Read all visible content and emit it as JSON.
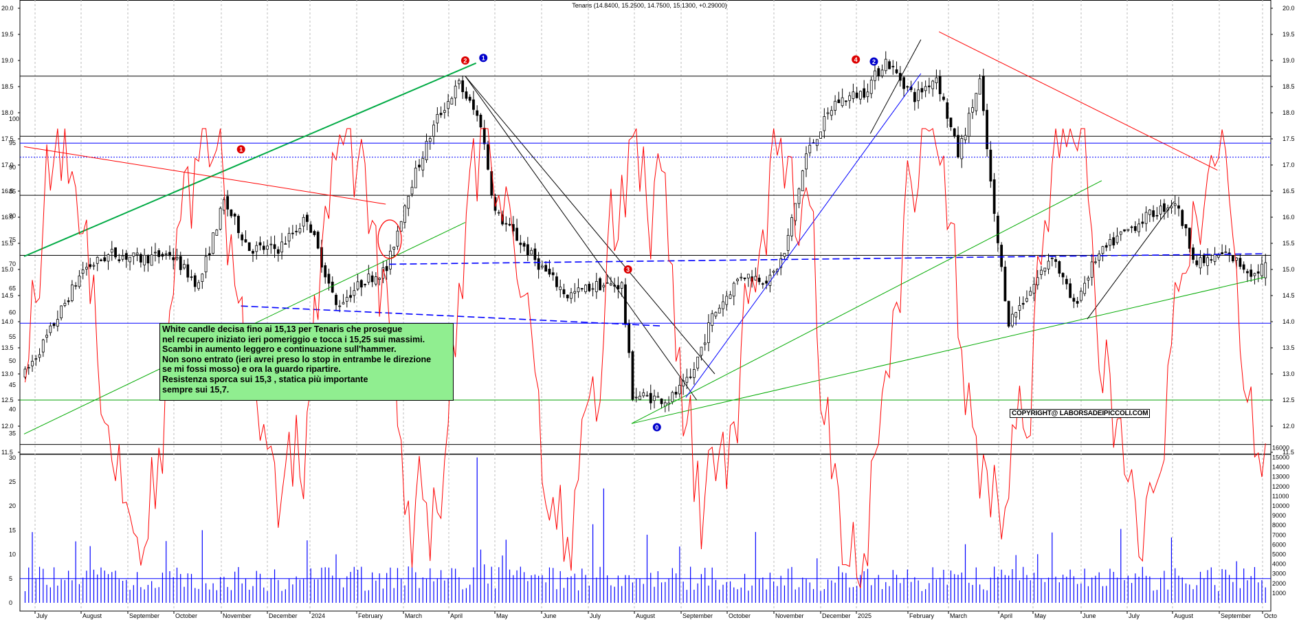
{
  "header": {
    "title": "Tenaris (14.8400, 15.2500, 14.7500, 15.1300, +0.29000)"
  },
  "note": {
    "lines": [
      "White candle decisa fino ai 15,13 per Tenaris che prosegue",
      "nel recupero iniziato ieri pomeriggio e tocca i 15,25 sui massimi.",
      "Scambi in aumento leggero e continuazione sull'hammer.",
      "Non sono entrato (ieri avrei preso lo stop in entrambe le direzione",
      "se mi fossi mosso) e ora la guardo ripartire.",
      "Resistenza sporca sui 15,3 , statica più importante",
      "sempre sui 15,7."
    ]
  },
  "copyright": "COPYRIGHT@ LABORSADEIPICCOLI.COM",
  "chart_data": [
    {
      "type": "candlestick",
      "title": "Tenaris (14.8400, 15.2500, 14.7500, 15.1300, +0.29000)",
      "ylim": [
        11.2,
        20.1
      ],
      "y_ticks": [
        "11.5",
        "12.0",
        "12.5",
        "13.0",
        "13.5",
        "14.0",
        "14.5",
        "15.0",
        "15.5",
        "16.0",
        "16.5",
        "17.0",
        "17.5",
        "18.0",
        "18.5",
        "19.0",
        "19.5",
        "20.0"
      ],
      "x_ticks": [
        "July",
        "August",
        "September",
        "October",
        "November",
        "December",
        "2024",
        "February",
        "March",
        "April",
        "May",
        "June",
        "July",
        "August",
        "September",
        "October",
        "November",
        "December",
        "2025",
        "February",
        "March",
        "April",
        "May",
        "June",
        "July",
        "August",
        "September",
        "Octo"
      ],
      "last": {
        "open": 14.84,
        "high": 15.25,
        "low": 14.75,
        "close": 15.13,
        "change": 0.29
      },
      "price_path": [
        [
          0,
          13.0
        ],
        [
          6,
          13.7
        ],
        [
          16,
          15.0
        ],
        [
          24,
          15.3
        ],
        [
          32,
          15.2
        ],
        [
          40,
          15.3
        ],
        [
          48,
          14.7
        ],
        [
          55,
          16.3
        ],
        [
          62,
          15.4
        ],
        [
          70,
          15.4
        ],
        [
          78,
          16.0
        ],
        [
          86,
          14.3
        ],
        [
          94,
          14.8
        ],
        [
          100,
          15.0
        ],
        [
          106,
          16.5
        ],
        [
          114,
          17.9
        ],
        [
          120,
          18.55
        ],
        [
          126,
          17.8
        ],
        [
          130,
          16.1
        ],
        [
          136,
          15.6
        ],
        [
          142,
          15.1
        ],
        [
          150,
          14.5
        ],
        [
          158,
          14.7
        ],
        [
          165,
          14.7
        ],
        [
          168,
          12.6
        ],
        [
          178,
          12.5
        ],
        [
          184,
          12.9
        ],
        [
          190,
          14.1
        ],
        [
          198,
          14.9
        ],
        [
          206,
          14.8
        ],
        [
          210,
          15.3
        ],
        [
          216,
          17.2
        ],
        [
          224,
          18.2
        ],
        [
          232,
          18.4
        ],
        [
          238,
          19.0
        ],
        [
          246,
          18.3
        ],
        [
          252,
          18.7
        ],
        [
          258,
          17.2
        ],
        [
          264,
          18.6
        ],
        [
          268,
          16.0
        ],
        [
          272,
          14.0
        ],
        [
          278,
          14.6
        ],
        [
          284,
          15.3
        ],
        [
          290,
          14.3
        ],
        [
          296,
          15.2
        ],
        [
          302,
          15.6
        ],
        [
          310,
          16.0
        ],
        [
          318,
          16.3
        ],
        [
          324,
          15.1
        ],
        [
          332,
          15.3
        ],
        [
          340,
          14.9
        ],
        [
          343,
          15.13
        ]
      ],
      "levels": [
        {
          "value": 18.7,
          "color": "#000000"
        },
        {
          "value": 17.55,
          "color": "#000000"
        },
        {
          "value": 17.15,
          "color": "#0000ff",
          "style": "dotted"
        },
        {
          "value": 16.42,
          "color": "#000000"
        },
        {
          "value": 15.27,
          "color": "#000000"
        },
        {
          "value": 13.97,
          "color": "#0000ff"
        },
        {
          "value": 12.5,
          "color": "#00a000"
        },
        {
          "value": 11.65,
          "color": "#000000"
        }
      ],
      "trendlines": [
        {
          "color": "#00aa44",
          "from": [
            0,
            15.25
          ],
          "to": [
            125,
            18.95
          ],
          "width": 2
        },
        {
          "color": "#00aa00",
          "from": [
            0,
            11.85
          ],
          "to": [
            122,
            15.9
          ]
        },
        {
          "color": "#ff0000",
          "from": [
            0,
            17.35
          ],
          "to": [
            100,
            16.25
          ]
        },
        {
          "color": "#000000",
          "from": [
            122,
            18.7
          ],
          "to": [
            186,
            12.5
          ]
        },
        {
          "color": "#000000",
          "from": [
            122,
            18.7
          ],
          "to": [
            191,
            13.0
          ]
        },
        {
          "color": "#00aa00",
          "from": [
            168,
            12.05
          ],
          "to": [
            298,
            16.7
          ]
        },
        {
          "color": "#00aa00",
          "from": [
            168,
            12.05
          ],
          "to": [
            343,
            14.85
          ]
        },
        {
          "color": "#0000ff",
          "from": [
            183,
            12.55
          ],
          "to": [
            248,
            18.75
          ]
        },
        {
          "color": "#000000",
          "from": [
            234,
            17.6
          ],
          "to": [
            248,
            19.4
          ]
        },
        {
          "color": "#ff0000",
          "from": [
            253,
            19.55
          ],
          "to": [
            330,
            16.9
          ]
        },
        {
          "color": "#000000",
          "from": [
            294,
            14.05
          ],
          "to": [
            318,
            16.3
          ]
        },
        {
          "color": "#0000ff",
          "from": [
            101,
            15.1
          ],
          "to": [
            343,
            15.3
          ],
          "style": "dashed"
        },
        {
          "color": "#0000ff",
          "from": [
            60,
            14.3
          ],
          "to": [
            176,
            13.92
          ],
          "style": "dashed"
        }
      ],
      "markers": [
        {
          "label": "1",
          "color": "#dd0000",
          "x": 60,
          "y": 17.3
        },
        {
          "label": "2",
          "color": "#dd0000",
          "x": 122,
          "y": 19.0
        },
        {
          "label": "1",
          "color": "#0000cc",
          "x": 127,
          "y": 19.05
        },
        {
          "label": "3",
          "color": "#dd0000",
          "x": 167,
          "y": 15.0
        },
        {
          "label": "0",
          "color": "#0000cc",
          "x": 175,
          "y": 11.98
        },
        {
          "label": "4",
          "color": "#dd0000",
          "x": 230,
          "y": 19.02
        },
        {
          "label": "2",
          "color": "#0000cc",
          "x": 235,
          "y": 18.98
        }
      ]
    },
    {
      "type": "line+bar",
      "ylim_left": [
        0,
        100
      ],
      "ylim_right": [
        0,
        16000
      ],
      "y_ticks_left": [
        "0",
        "5",
        "10",
        "15",
        "20",
        "25",
        "30",
        "35",
        "40",
        "45",
        "50",
        "55",
        "60",
        "65",
        "70",
        "75",
        "80",
        "85",
        "90",
        "95",
        "100"
      ],
      "y_ticks_right": [
        "1000",
        "2000",
        "3000",
        "4000",
        "5000",
        "6000",
        "7000",
        "8000",
        "9000",
        "10000",
        "11000",
        "12000",
        "13000",
        "14000",
        "15000",
        "16000"
      ],
      "series": [
        {
          "kind": "oscillator",
          "color": "#ff0000"
        },
        {
          "kind": "volume",
          "color": "#0000ff"
        }
      ],
      "levels": [
        {
          "value": 95,
          "color": "#0000ff"
        },
        {
          "value": 5,
          "color": "#0000ff"
        }
      ]
    }
  ]
}
